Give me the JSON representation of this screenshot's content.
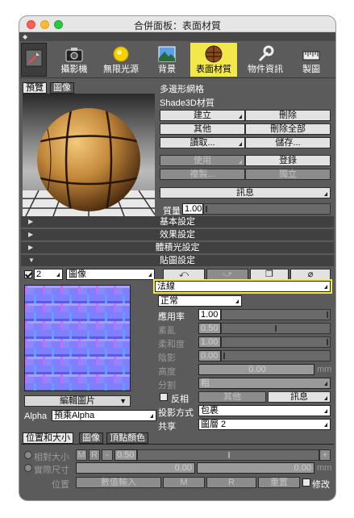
{
  "window": {
    "title": "合併面板：表面材質"
  },
  "toolbar": {
    "items": [
      "",
      "攝影機",
      "無限光源",
      "背景",
      "表面材質",
      "物件資訊",
      "製圖"
    ]
  },
  "preview_tabs": [
    "預覽",
    "圖像"
  ],
  "object": {
    "type": "多邊形網格",
    "material": "Shade3D材質"
  },
  "buttons": {
    "create": "建立",
    "delete": "刪除",
    "other": "其他",
    "delete_all": "刪除全部",
    "read": "讀取...",
    "save": "儲存...",
    "use": "使用",
    "register": "登錄",
    "copy": "複製...",
    "independent": "獨立",
    "info": "訊息"
  },
  "quality": {
    "label": "質量",
    "value": "1.00"
  },
  "sections": {
    "basic": "基本設定",
    "effect": "效果設定",
    "volume": "體積光設定",
    "texture": "貼圖設定"
  },
  "texture": {
    "layer_num": "2",
    "layer_type": "圖像",
    "mapping": "法線",
    "blend": "正常",
    "apply_label": "應用率",
    "apply_value": "1.00",
    "rough_label": "紊亂",
    "rough_value": "0.50",
    "soft_label": "柔和度",
    "soft_value": "1.00",
    "shadow_label": "陰影",
    "shadow_value": "0.00",
    "height_label": "高度",
    "height_value": "0.00",
    "height_unit": "mm",
    "split_label": "分割",
    "split_value": "粗",
    "invert_label": "反相",
    "other2": "其他",
    "info2": "訊息",
    "proj_label": "投影方式",
    "proj_value": "包裹",
    "share_label": "共享",
    "share_value": "圖層 2",
    "edit_image": "編輯圖片",
    "alpha_label": "Alpha",
    "alpha_value": "預乘Alpha"
  },
  "bottom_tabs": [
    "位置和大小",
    "圖像",
    "頂點顏色"
  ],
  "position": {
    "relative_label": "相對大小",
    "m": "M",
    "r": "R",
    "dash": "-",
    "relative_value": "0.50",
    "plus": "+",
    "actual_label": "實際尺寸",
    "val1": "0.00",
    "val2": "0.00",
    "unit": "mm",
    "pos_label": "位置",
    "num_input": "數值輸入",
    "m2": "M",
    "r2": "R",
    "reset": "重置",
    "modify": "修改"
  },
  "colors": {
    "accent": "#f2e84a",
    "panel": "#5b5b5b",
    "normal_map": "#7f7fff"
  }
}
